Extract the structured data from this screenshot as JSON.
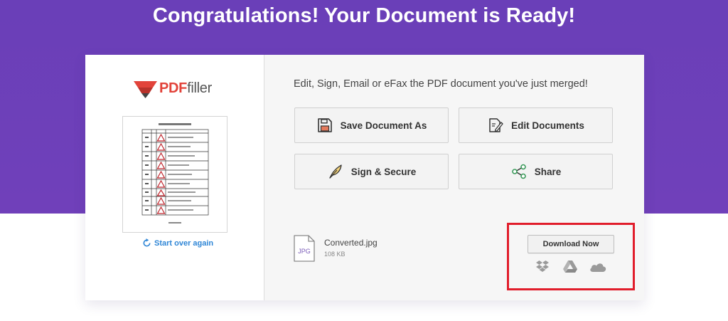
{
  "hero": {
    "title": "Congratulations! Your Document is Ready!"
  },
  "brand": {
    "logo_pdf": "PDF",
    "logo_filler": "filler",
    "accent": "#e2433a"
  },
  "left": {
    "start_over_label": "Start over again",
    "link_color": "#2f86d6"
  },
  "right": {
    "heading": "Edit, Sign, Email or eFax the PDF document you've just merged!",
    "actions": [
      {
        "label": "Save Document As",
        "icon": "floppy-disk-icon"
      },
      {
        "label": "Edit Documents",
        "icon": "edit-document-icon"
      },
      {
        "label": "Sign & Secure",
        "icon": "feather-pen-icon"
      },
      {
        "label": "Share",
        "icon": "share-icon"
      }
    ]
  },
  "file": {
    "name": "Converted.jpg",
    "size": "108 KB",
    "badge": "JPG"
  },
  "download": {
    "label": "Download Now",
    "destinations": [
      "dropbox-icon",
      "google-drive-icon",
      "onedrive-icon"
    ]
  },
  "colors": {
    "hero_purple": "#6a3fb8",
    "highlight_red": "#e11d2b"
  }
}
